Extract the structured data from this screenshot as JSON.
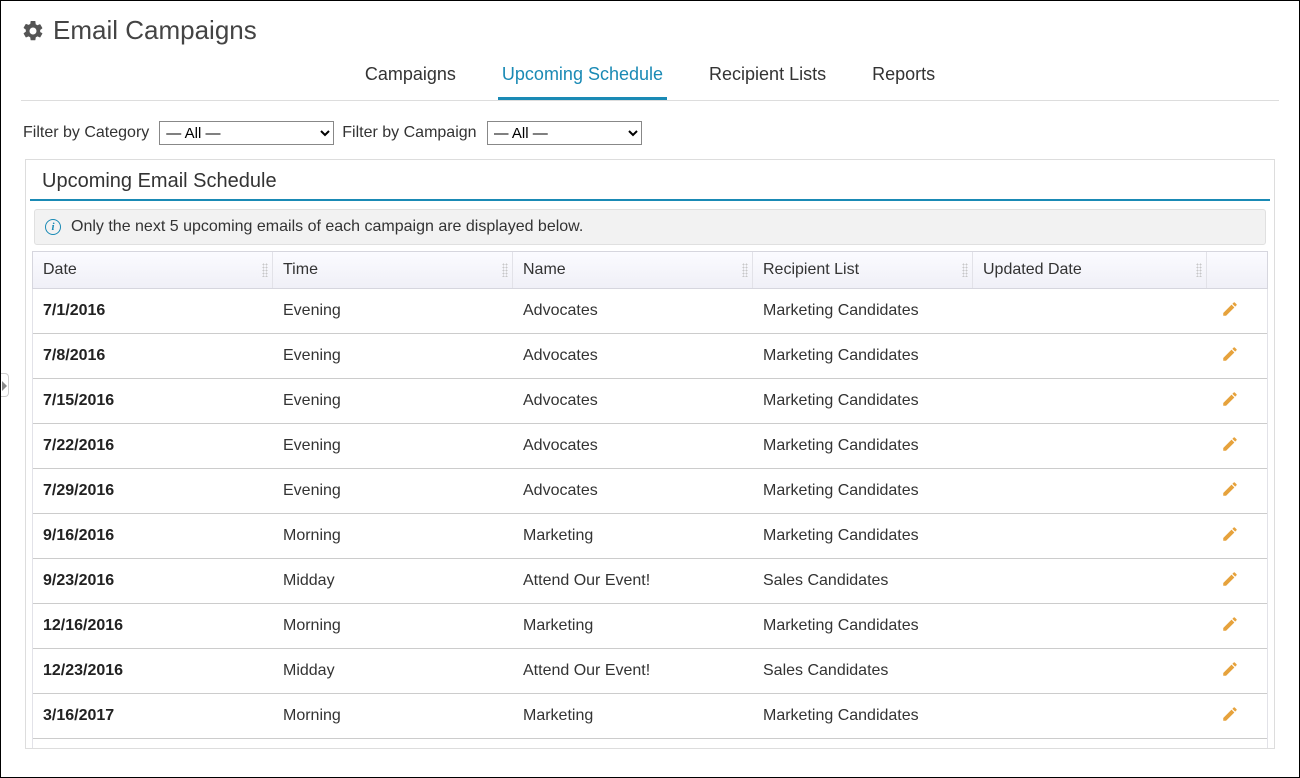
{
  "header": {
    "title": "Email Campaigns"
  },
  "tabs": [
    {
      "label": "Campaigns",
      "active": false
    },
    {
      "label": "Upcoming Schedule",
      "active": true
    },
    {
      "label": "Recipient Lists",
      "active": false
    },
    {
      "label": "Reports",
      "active": false
    }
  ],
  "filters": {
    "category_label": "Filter by Category",
    "category_value": "— All —",
    "campaign_label": "Filter by Campaign",
    "campaign_value": "— All —"
  },
  "panel": {
    "title": "Upcoming Email Schedule",
    "info_text": "Only the next 5 upcoming emails of each campaign are displayed below."
  },
  "columns": {
    "date": "Date",
    "time": "Time",
    "name": "Name",
    "recipient": "Recipient List",
    "updated": "Updated Date"
  },
  "rows": [
    {
      "date": "7/1/2016",
      "time": "Evening",
      "name": "Advocates",
      "recipient": "Marketing Candidates",
      "updated": ""
    },
    {
      "date": "7/8/2016",
      "time": "Evening",
      "name": "Advocates",
      "recipient": "Marketing Candidates",
      "updated": ""
    },
    {
      "date": "7/15/2016",
      "time": "Evening",
      "name": "Advocates",
      "recipient": "Marketing Candidates",
      "updated": ""
    },
    {
      "date": "7/22/2016",
      "time": "Evening",
      "name": "Advocates",
      "recipient": "Marketing Candidates",
      "updated": ""
    },
    {
      "date": "7/29/2016",
      "time": "Evening",
      "name": "Advocates",
      "recipient": "Marketing Candidates",
      "updated": ""
    },
    {
      "date": "9/16/2016",
      "time": "Morning",
      "name": "Marketing",
      "recipient": "Marketing Candidates",
      "updated": ""
    },
    {
      "date": "9/23/2016",
      "time": "Midday",
      "name": "Attend Our Event!",
      "recipient": "Sales Candidates",
      "updated": ""
    },
    {
      "date": "12/16/2016",
      "time": "Morning",
      "name": "Marketing",
      "recipient": "Marketing Candidates",
      "updated": ""
    },
    {
      "date": "12/23/2016",
      "time": "Midday",
      "name": "Attend Our Event!",
      "recipient": "Sales Candidates",
      "updated": ""
    },
    {
      "date": "3/16/2017",
      "time": "Morning",
      "name": "Marketing",
      "recipient": "Marketing Candidates",
      "updated": ""
    }
  ]
}
